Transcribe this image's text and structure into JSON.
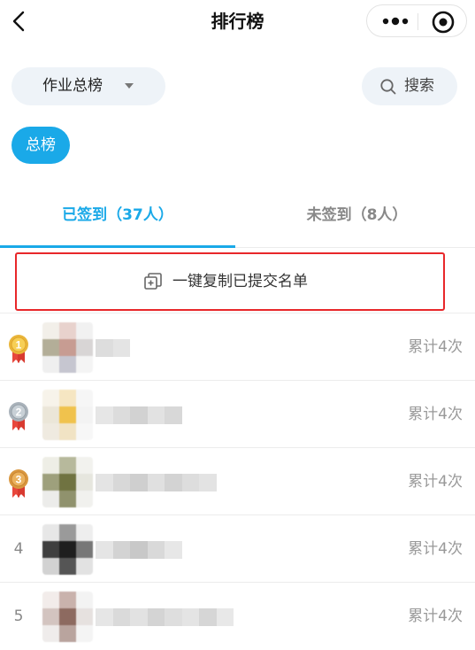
{
  "header": {
    "title": "排行榜"
  },
  "filter": {
    "label": "作业总榜"
  },
  "search": {
    "label": "搜索"
  },
  "chip": {
    "label": "总榜"
  },
  "tabs": [
    {
      "label": "已签到（37人）"
    },
    {
      "label": "未签到（8人）"
    }
  ],
  "copy_button": {
    "label": "一键复制已提交名单"
  },
  "colors": {
    "accent": "#1aa9e8",
    "highlight_border": "#e8272a"
  },
  "rows": [
    {
      "rank": "1",
      "medal": "gold-medal-icon",
      "count": "累计4次"
    },
    {
      "rank": "2",
      "medal": "silver-medal-icon",
      "count": "累计4次"
    },
    {
      "rank": "3",
      "medal": "bronze-medal-icon",
      "count": "累计4次"
    },
    {
      "rank": "4",
      "count": "累计4次"
    },
    {
      "rank": "5",
      "count": "累计4次"
    }
  ]
}
